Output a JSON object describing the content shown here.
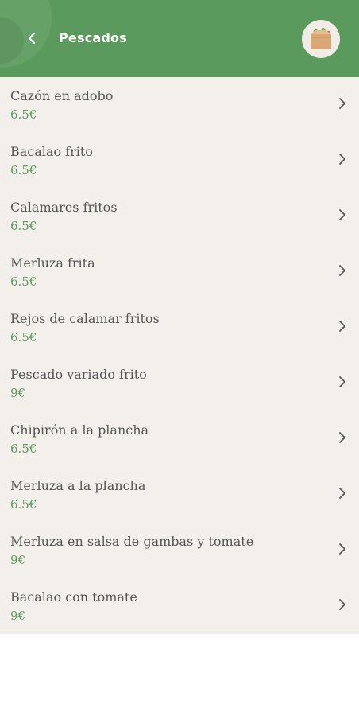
{
  "header": {
    "title": "Pescados",
    "back_icon": "chevron-left-icon",
    "cart_icon": "grocery-bag-icon",
    "background_color": "#5a9a5c"
  },
  "items": [
    {
      "name": "Cazón en adobo",
      "price": "6.5€"
    },
    {
      "name": "Bacalao frito",
      "price": "6.5€"
    },
    {
      "name": "Calamares fritos",
      "price": "6.5€"
    },
    {
      "name": "Merluza frita",
      "price": "6.5€"
    },
    {
      "name": "Rejos de calamar fritos",
      "price": "6.5€"
    },
    {
      "name": "Pescado variado frito",
      "price": "9€"
    },
    {
      "name": "Chipirón a la plancha",
      "price": "6.5€"
    },
    {
      "name": "Merluza a la plancha",
      "price": "6.5€"
    },
    {
      "name": "Merluza en salsa de gambas y tomate",
      "price": "9€"
    },
    {
      "name": "Bacalao con tomate",
      "price": "9€"
    }
  ],
  "colors": {
    "price": "#5b9b5e",
    "list_background": "#f3f0ec",
    "text": "#555555"
  }
}
